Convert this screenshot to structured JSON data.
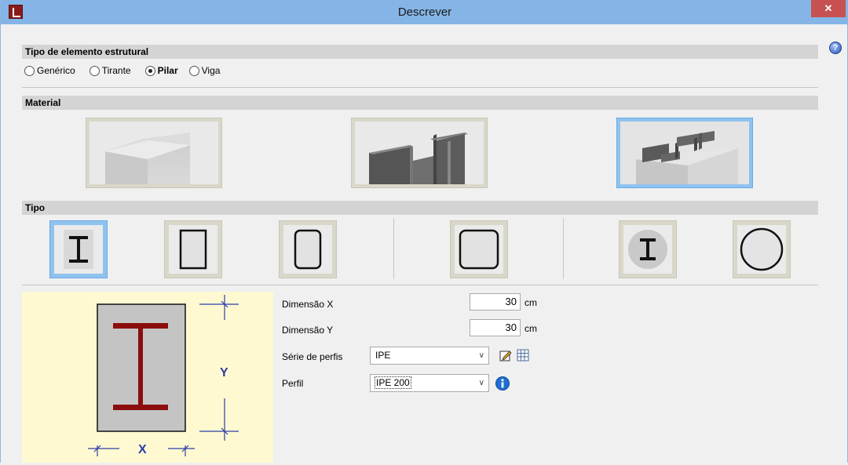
{
  "window": {
    "title": "Descrever",
    "close_glyph": "✕"
  },
  "help": {
    "glyph": "?"
  },
  "tipo_elemento": {
    "heading": "Tipo de elemento estrutural",
    "options": [
      {
        "label": "Genérico",
        "checked": false
      },
      {
        "label": "Tirante",
        "checked": false
      },
      {
        "label": "Pilar",
        "checked": true
      },
      {
        "label": "Viga",
        "checked": false
      }
    ]
  },
  "material": {
    "heading": "Material",
    "options": [
      {
        "name": "concrete",
        "selected": false
      },
      {
        "name": "steel",
        "selected": false
      },
      {
        "name": "mixed",
        "selected": true
      }
    ]
  },
  "tipo": {
    "heading": "Tipo",
    "options": [
      {
        "name": "i-section",
        "selected": true
      },
      {
        "name": "rectangular",
        "selected": false
      },
      {
        "name": "rectangular-rounded",
        "selected": false
      },
      {
        "name": "square-rounded",
        "selected": false
      },
      {
        "name": "circular-with-i",
        "selected": false
      },
      {
        "name": "circular",
        "selected": false
      }
    ]
  },
  "preview": {
    "x_label": "X",
    "y_label": "Y"
  },
  "form": {
    "dim_x": {
      "label": "Dimensão X",
      "value": "30",
      "unit": "cm"
    },
    "dim_y": {
      "label": "Dimensão Y",
      "value": "30",
      "unit": "cm"
    },
    "serie": {
      "label": "Série de perfis",
      "value": "IPE"
    },
    "perfil": {
      "label": "Perfil",
      "value": "IPE 200"
    },
    "arrow_glyph": "∨"
  },
  "colors": {
    "titlebar": "#85b5e6",
    "selected": "#8fc3ef",
    "profile": "#8b0d0d",
    "dim_blue": "#2a3ea8",
    "preview_bg": "#fff9d2"
  }
}
